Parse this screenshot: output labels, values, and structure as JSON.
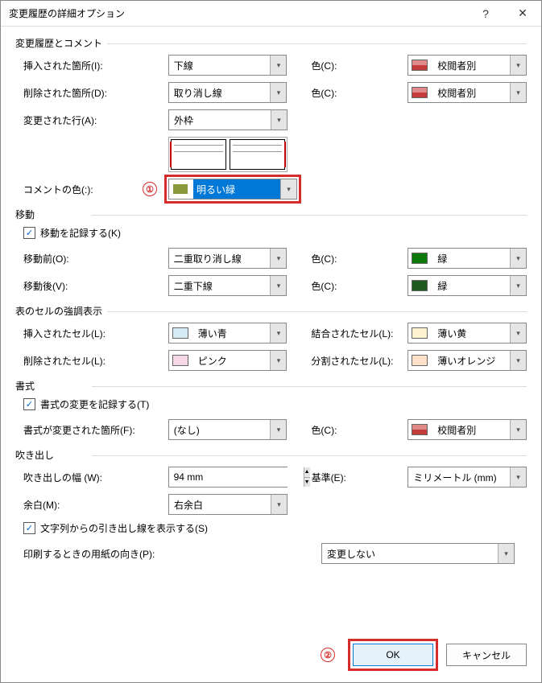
{
  "title": "変更履歴の詳細オプション",
  "annotations": {
    "one": "①",
    "two": "②"
  },
  "sections": {
    "s1": {
      "header": "変更履歴とコメント",
      "insertions_label": "挿入された箇所(I):",
      "insertions_value": "下線",
      "deletions_label": "削除された箇所(D):",
      "deletions_value": "取り消し線",
      "changed_lines_label": "変更された行(A):",
      "changed_lines_value": "外枠",
      "comments_label": "コメントの色(:):",
      "comments_value": "明るい緑",
      "color_label": "色(C):",
      "color_value": "校閲者別"
    },
    "s2": {
      "header": "移動",
      "track_label": "移動を記録する(K)",
      "moved_from_label": "移動前(O):",
      "moved_from_value": "二重取り消し線",
      "moved_to_label": "移動後(V):",
      "moved_to_value": "二重下線",
      "color_label": "色(C):",
      "color_value": "緑"
    },
    "s3": {
      "header": "表のセルの強調表示",
      "inserted_label": "挿入されたセル(L):",
      "inserted_value": "薄い青",
      "deleted_label": "削除されたセル(L):",
      "deleted_value": "ピンク",
      "merged_label": "結合されたセル(L):",
      "merged_value": "薄い黄",
      "split_label": "分割されたセル(L):",
      "split_value": "薄いオレンジ"
    },
    "s4": {
      "header": "書式",
      "track_label": "書式の変更を記録する(T)",
      "formatting_label": "書式が変更された箇所(F):",
      "formatting_value": "(なし)",
      "color_label": "色(C):",
      "color_value": "校閲者別"
    },
    "s5": {
      "header": "吹き出し",
      "width_label": "吹き出しの幅 (W):",
      "width_value": "94 mm",
      "measure_label": "基準(E):",
      "measure_value": "ミリメートル (mm)",
      "margin_label": "余白(M):",
      "margin_value": "右余白",
      "show_lines_label": "文字列からの引き出し線を表示する(S)",
      "orientation_label": "印刷するときの用紙の向き(P):",
      "orientation_value": "変更しない"
    }
  },
  "colors": {
    "by_author": "#c33b3b",
    "by_author_light": "#e08a8a",
    "bright_green": "#8a9a3a",
    "green": "#0b7a0b",
    "dark_green": "#1e5a1e",
    "light_blue": "#d6ecf5",
    "pink": "#f7d6e6",
    "light_yellow": "#fdf3d0",
    "light_orange": "#fce0c8"
  },
  "buttons": {
    "ok": "OK",
    "cancel": "キャンセル"
  }
}
